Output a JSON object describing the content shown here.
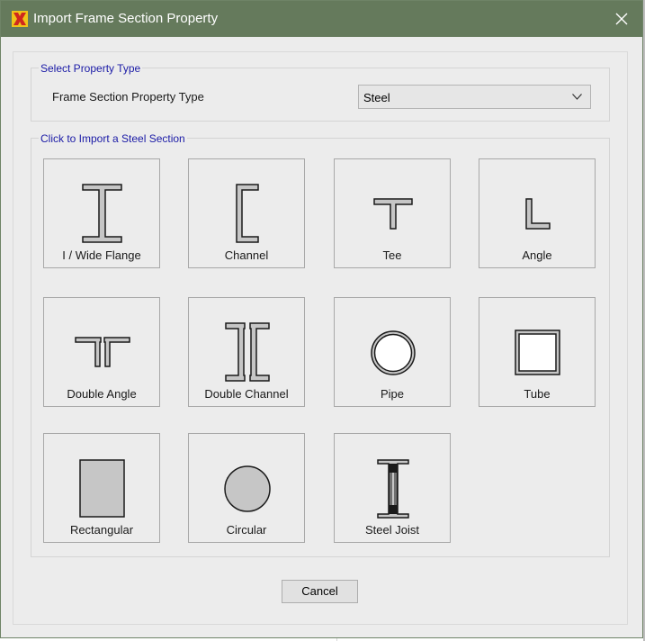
{
  "window": {
    "title": "Import Frame Section Property"
  },
  "property_type": {
    "group_title": "Select Property Type",
    "label": "Frame Section Property Type",
    "selected": "Steel"
  },
  "sections": {
    "group_title": "Click to Import a Steel Section",
    "items": [
      {
        "label": "I / Wide Flange",
        "icon": "i-beam-icon"
      },
      {
        "label": "Channel",
        "icon": "channel-icon"
      },
      {
        "label": "Tee",
        "icon": "tee-icon"
      },
      {
        "label": "Angle",
        "icon": "angle-icon"
      },
      {
        "label": "Double Angle",
        "icon": "double-angle-icon"
      },
      {
        "label": "Double Channel",
        "icon": "double-channel-icon"
      },
      {
        "label": "Pipe",
        "icon": "pipe-icon"
      },
      {
        "label": "Tube",
        "icon": "tube-icon"
      },
      {
        "label": "Rectangular",
        "icon": "rectangle-icon"
      },
      {
        "label": "Circular",
        "icon": "circle-icon"
      },
      {
        "label": "Steel Joist",
        "icon": "steel-joist-icon"
      }
    ]
  },
  "buttons": {
    "cancel": "Cancel"
  },
  "colors": {
    "titlebar": "#657a5c",
    "group_title": "#1a1aa6",
    "shape_fill": "#c6c6c6"
  }
}
